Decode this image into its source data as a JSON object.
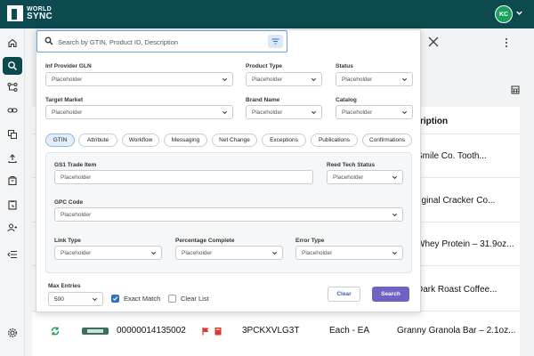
{
  "app": {
    "logo_line1": "WORLD",
    "logo_line2": "SYNC",
    "user_initials": "KC"
  },
  "sidebar": {
    "items": [
      {
        "icon": "home-icon"
      },
      {
        "icon": "search-icon"
      },
      {
        "icon": "hierarchy-icon"
      },
      {
        "icon": "link-icon"
      },
      {
        "icon": "copy-icon"
      },
      {
        "icon": "upload-icon"
      },
      {
        "icon": "package-icon"
      },
      {
        "icon": "clipboard-icon"
      },
      {
        "icon": "users-icon"
      },
      {
        "icon": "collapse-icon"
      },
      {
        "icon": "gear-icon"
      }
    ]
  },
  "background": {
    "column_header": "ription",
    "rows": [
      "Smile Co. Tooth...",
      "riginal Cracker Co...",
      "Whey Protein – 31.9oz...",
      "Dark Roast Coffee...",
      "Granny Granola Bar – 2.1oz..."
    ],
    "last_row": {
      "gtin": "00000014135002",
      "product_id": "3PCKXVLG3T",
      "unit": "Each - EA"
    }
  },
  "search": {
    "placeholder": "Search by GTIN, Product ID, Description"
  },
  "filters": {
    "info_provider_gln": {
      "label": "Inf Provider GLN",
      "value": "Placeholder"
    },
    "product_type": {
      "label": "Product Type",
      "value": "Placeholder"
    },
    "status": {
      "label": "Status",
      "value": "Placeholder"
    },
    "target_market": {
      "label": "Target Market",
      "value": "Placeholder"
    },
    "brand_name": {
      "label": "Brand Name",
      "value": "Placeholder"
    },
    "catalog": {
      "label": "Catalog",
      "value": "Placeholder"
    }
  },
  "tabs": [
    "GTIN",
    "Attribute",
    "Workflow",
    "Messaging",
    "Net Change",
    "Exceptions",
    "Publications",
    "Confirmations"
  ],
  "active_tab": "GTIN",
  "gtin_panel": {
    "gs1_trade_item": {
      "label": "GS1 Trade Item",
      "placeholder": "Placeholder"
    },
    "reed_tech_status": {
      "label": "Reed Tech Status",
      "value": "Placeholder"
    },
    "gpc_code": {
      "label": "GPC Code",
      "value": "Placeholder"
    },
    "link_type": {
      "label": "Link Type",
      "value": "Placeholder"
    },
    "percentage_complete": {
      "label": "Percentage Complete",
      "value": "Placeholder"
    },
    "error_type": {
      "label": "Error Type",
      "value": "Placeholder"
    }
  },
  "footer": {
    "max_entries_label": "Max Entries",
    "max_entries_value": "500",
    "exact_match": {
      "label": "Exact Match",
      "checked": true
    },
    "clear_list": {
      "label": "Clear List",
      "checked": false
    },
    "clear_button": "Clear",
    "search_button": "Search"
  },
  "colors": {
    "header": "#0c4a4f",
    "accent": "#6c63c4",
    "avatar": "#19a05a",
    "checkbox": "#2f72c8"
  }
}
